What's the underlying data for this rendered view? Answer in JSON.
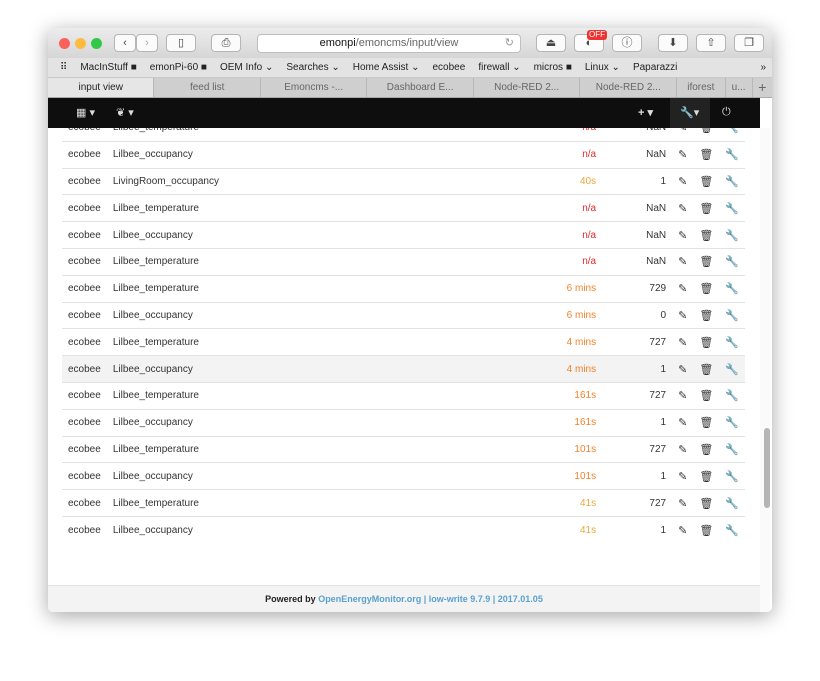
{
  "browser": {
    "url_host": "emonpi",
    "url_path": "/emoncms/input/view",
    "badge": "OFF",
    "bookmarks": [
      "MacInStuff ■",
      "emonPi-60 ■",
      "OEM Info ⌄",
      "Searches ⌄",
      "Home Assist ⌄",
      "ecobee",
      "firewall ⌄",
      "micros ■",
      "Linux ⌄",
      "Paparazzi"
    ],
    "tabs": [
      "input view",
      "feed list",
      "Emoncms -...",
      "Dashboard E...",
      "Node-RED 2...",
      "Node-RED 2...",
      "iforest",
      "u..."
    ]
  },
  "colors": {
    "na": "#e02a2a",
    "recent": "#e8a93a",
    "mins": "#f0822a"
  },
  "rows": [
    {
      "node": "ecobee",
      "name": "Lilbee_temperature",
      "time": "n/a",
      "value": "NaN",
      "c": "na"
    },
    {
      "node": "ecobee",
      "name": "Lilbee_occupancy",
      "time": "n/a",
      "value": "NaN",
      "c": "na"
    },
    {
      "node": "ecobee",
      "name": "LivingRoom_occupancy",
      "time": "40s",
      "value": "1",
      "c": "recent"
    },
    {
      "node": "ecobee",
      "name": "Lilbee_temperature",
      "time": "n/a",
      "value": "NaN",
      "c": "na"
    },
    {
      "node": "ecobee",
      "name": "Lilbee_occupancy",
      "time": "n/a",
      "value": "NaN",
      "c": "na"
    },
    {
      "node": "ecobee",
      "name": "Lilbee_temperature",
      "time": "n/a",
      "value": "NaN",
      "c": "na"
    },
    {
      "node": "ecobee",
      "name": "Lilbee_temperature",
      "time": "6 mins",
      "value": "729",
      "c": "mins"
    },
    {
      "node": "ecobee",
      "name": "Lilbee_occupancy",
      "time": "6 mins",
      "value": "0",
      "c": "mins"
    },
    {
      "node": "ecobee",
      "name": "Lilbee_temperature",
      "time": "4 mins",
      "value": "727",
      "c": "mins"
    },
    {
      "node": "ecobee",
      "name": "Lilbee_occupancy",
      "time": "4 mins",
      "value": "1",
      "c": "mins"
    },
    {
      "node": "ecobee",
      "name": "Lilbee_temperature",
      "time": "161s",
      "value": "727",
      "c": "mins"
    },
    {
      "node": "ecobee",
      "name": "Lilbee_occupancy",
      "time": "161s",
      "value": "1",
      "c": "mins"
    },
    {
      "node": "ecobee",
      "name": "Lilbee_temperature",
      "time": "101s",
      "value": "727",
      "c": "mins"
    },
    {
      "node": "ecobee",
      "name": "Lilbee_occupancy",
      "time": "101s",
      "value": "1",
      "c": "mins"
    },
    {
      "node": "ecobee",
      "name": "Lilbee_temperature",
      "time": "41s",
      "value": "727",
      "c": "recent"
    },
    {
      "node": "ecobee",
      "name": "Lilbee_occupancy",
      "time": "41s",
      "value": "1",
      "c": "recent"
    }
  ],
  "footer": {
    "prefix": "Powered by",
    "link": "OpenEnergyMonitor.org",
    "suffix": "| low-write 9.7.9 | 2017.01.05"
  }
}
